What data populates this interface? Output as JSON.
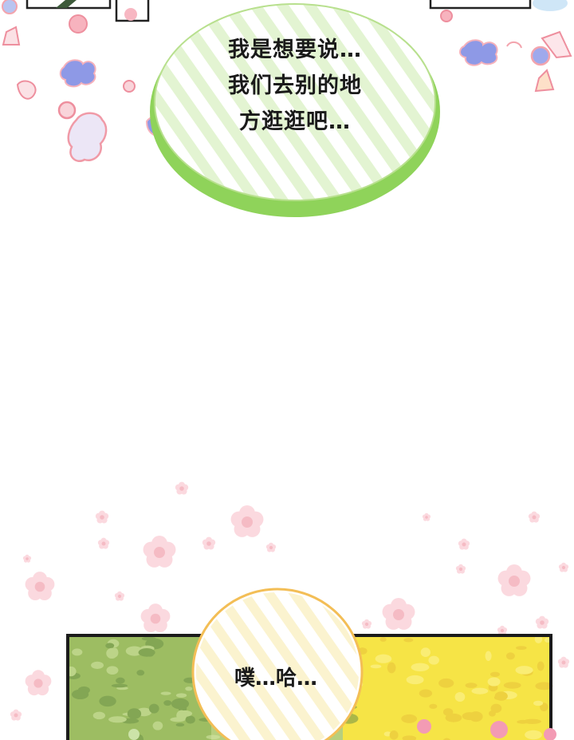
{
  "bubble_top": {
    "lines": [
      "我是想要说…",
      "我们去别的地",
      "方逛逛吧…"
    ]
  },
  "bubble_bottom": {
    "text": "噗…哈…"
  },
  "colors": {
    "background": "#ffffff",
    "green_border": "#8fd35a",
    "green_stripe": "#e3f4d2",
    "yellow_border": "#f3be56",
    "yellow_stripe": "#fbf3cf",
    "petal_pink": "#f9c9d2",
    "foliage_green": "#a9c77a",
    "foliage_yellow": "#f5e24a"
  }
}
